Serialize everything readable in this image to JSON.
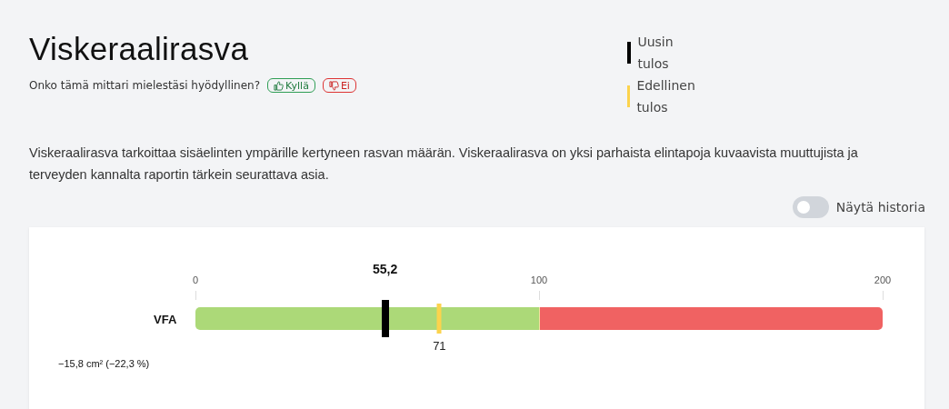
{
  "title": "Viskeraalirasva",
  "feedback": {
    "question": "Onko tämä mittari mielestäsi hyödyllinen?",
    "buttons": [
      {
        "kind": "yes",
        "label": "Kyllä"
      },
      {
        "kind": "no",
        "label": "Ei"
      }
    ]
  },
  "legend": [
    {
      "label": "Uusin tulos",
      "color": "#000000"
    },
    {
      "label": "Edellinen tulos",
      "color": "#fcd34d"
    }
  ],
  "description": "Viskeraalirasva tarkoittaa sisäelinten ympärille kertyneen rasvan määrän. Viskeraalirasva on yksi parhaista elintapoja kuvaavista muuttujista ja terveyden kannalta raportin tärkein seurattava asia.",
  "history_toggle": {
    "label": "Näytä historia",
    "on": false
  },
  "gauge": {
    "label": "VFA",
    "ticks": [
      "0",
      "100",
      "200"
    ],
    "segments": [
      {
        "color": "#acd978"
      },
      {
        "color": "#f06262"
      }
    ],
    "markers": [
      {
        "kind": "latest",
        "value": "55,2",
        "color": "#000000"
      },
      {
        "kind": "previous",
        "value": "71",
        "color": "#fcd34d"
      }
    ],
    "change": "−15,8 cm² (−22,3 %)"
  }
}
